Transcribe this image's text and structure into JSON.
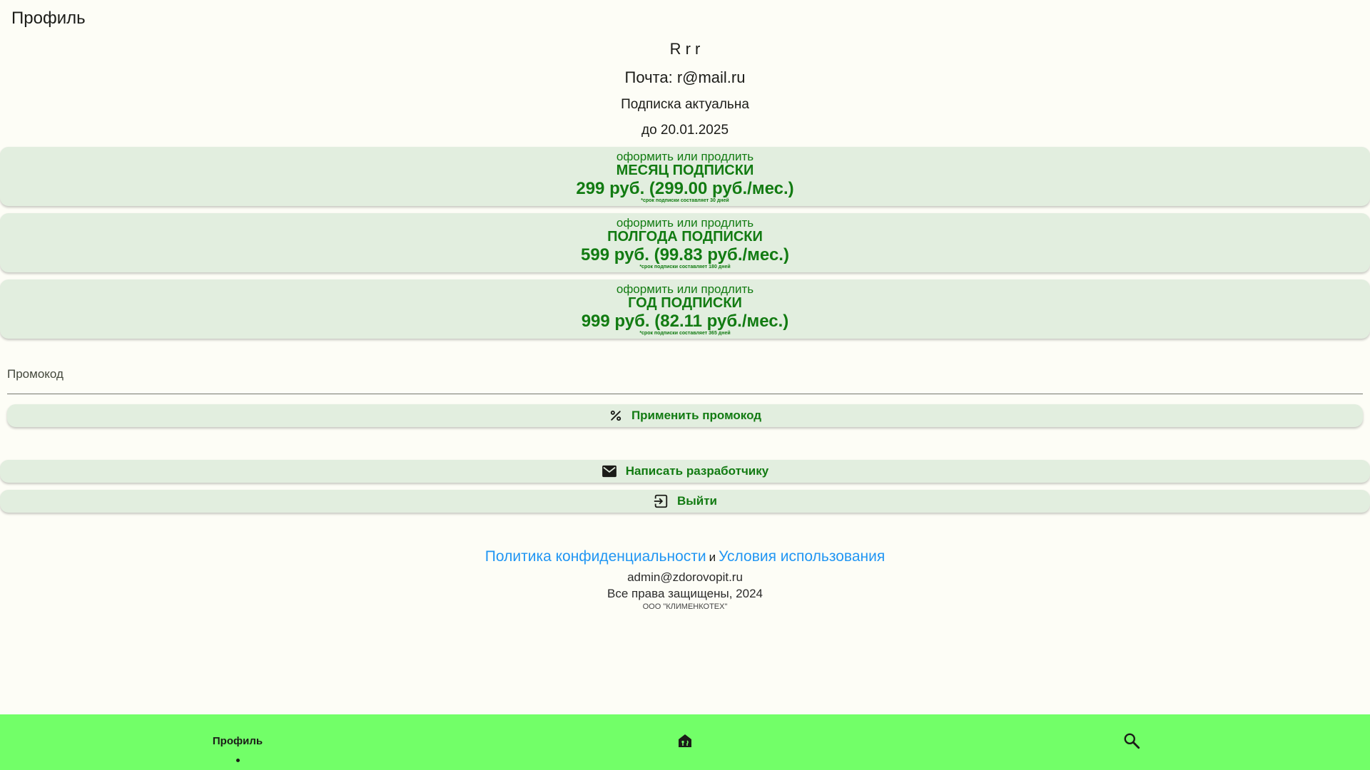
{
  "header": {
    "title": "Профиль"
  },
  "user": {
    "name": "R r r",
    "email": "Почта: r@mail.ru",
    "subscription_status": "Подписка актуальна",
    "subscription_until": "до 20.01.2025"
  },
  "plans": [
    {
      "action": "оформить или продлить",
      "title": "МЕСЯЦ ПОДПИСКИ",
      "price": "299 руб. (299.00 руб./мес.)",
      "note": "*срок подписки составляет 30 дней"
    },
    {
      "action": "оформить или продлить",
      "title": "ПОЛГОДА ПОДПИСКИ",
      "price": "599 руб. (99.83 руб./мес.)",
      "note": "*срок подписки составляет 180 дней"
    },
    {
      "action": "оформить или продлить",
      "title": "ГОД ПОДПИСКИ",
      "price": "999 руб. (82.11 руб./мес.)",
      "note": "*срок подписки составляет 365 дней"
    }
  ],
  "promo": {
    "placeholder": "Промокод",
    "value": "",
    "apply_label": "Применить промокод"
  },
  "actions": {
    "write_dev_label": "Написать разработчику",
    "logout_label": "Выйти"
  },
  "footer": {
    "privacy_label": "Политика конфиденциальности",
    "and_label": "и",
    "terms_label": "Условия использования",
    "email": "admin@zdorovopit.ru",
    "rights": "Все права защищены, 2024",
    "company": "ООО \"КЛИМЕНКОТЕХ\""
  },
  "bottom_nav": {
    "profile_label": "Профиль",
    "home_icon": "home-food-icon",
    "search_icon": "search-icon",
    "active": "profile"
  },
  "colors": {
    "background": "#fdfdf6",
    "card": "#e2eedf",
    "accent_text": "#127b12",
    "nav_bar": "#72ff68",
    "link": "#2196f3"
  }
}
